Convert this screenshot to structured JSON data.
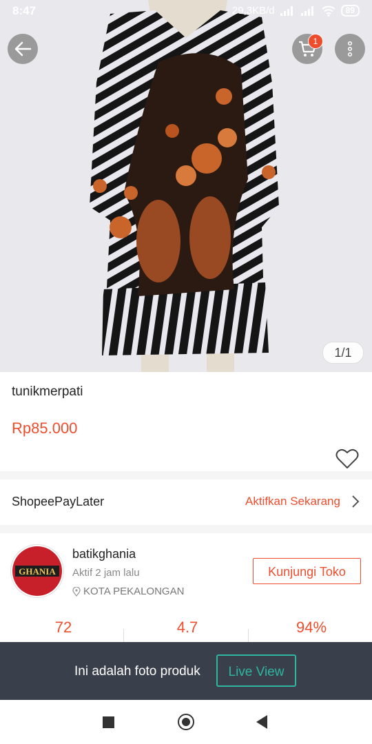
{
  "status_bar": {
    "time": "8:47",
    "network_speed": "29,3KB/d",
    "battery": "89"
  },
  "header": {
    "cart_count": "1"
  },
  "gallery": {
    "counter": "1/1"
  },
  "product": {
    "name": "tunikmerpati",
    "price": "Rp85.000"
  },
  "paylater": {
    "label": "ShopeePayLater",
    "action": "Aktifkan Sekarang"
  },
  "shop": {
    "name": "batikghania",
    "active": "Aktif 2 jam lalu",
    "location": "KOTA PEKALONGAN",
    "visit_label": "Kunjungi Toko",
    "logo_text": "GHANIA",
    "stats": [
      "72",
      "4.7",
      "94%"
    ]
  },
  "banner": {
    "text": "Ini adalah foto produk",
    "live_label": "Live View"
  },
  "colors": {
    "accent": "#ee4d2d",
    "teal": "#2db7a1",
    "banner_bg": "#3a3f4c"
  },
  "icons": [
    "back-arrow-icon",
    "cart-icon",
    "more-vertical-icon",
    "heart-icon",
    "chevron-right-icon",
    "location-pin-icon",
    "nav-recent-icon",
    "nav-home-icon",
    "nav-back-icon"
  ]
}
